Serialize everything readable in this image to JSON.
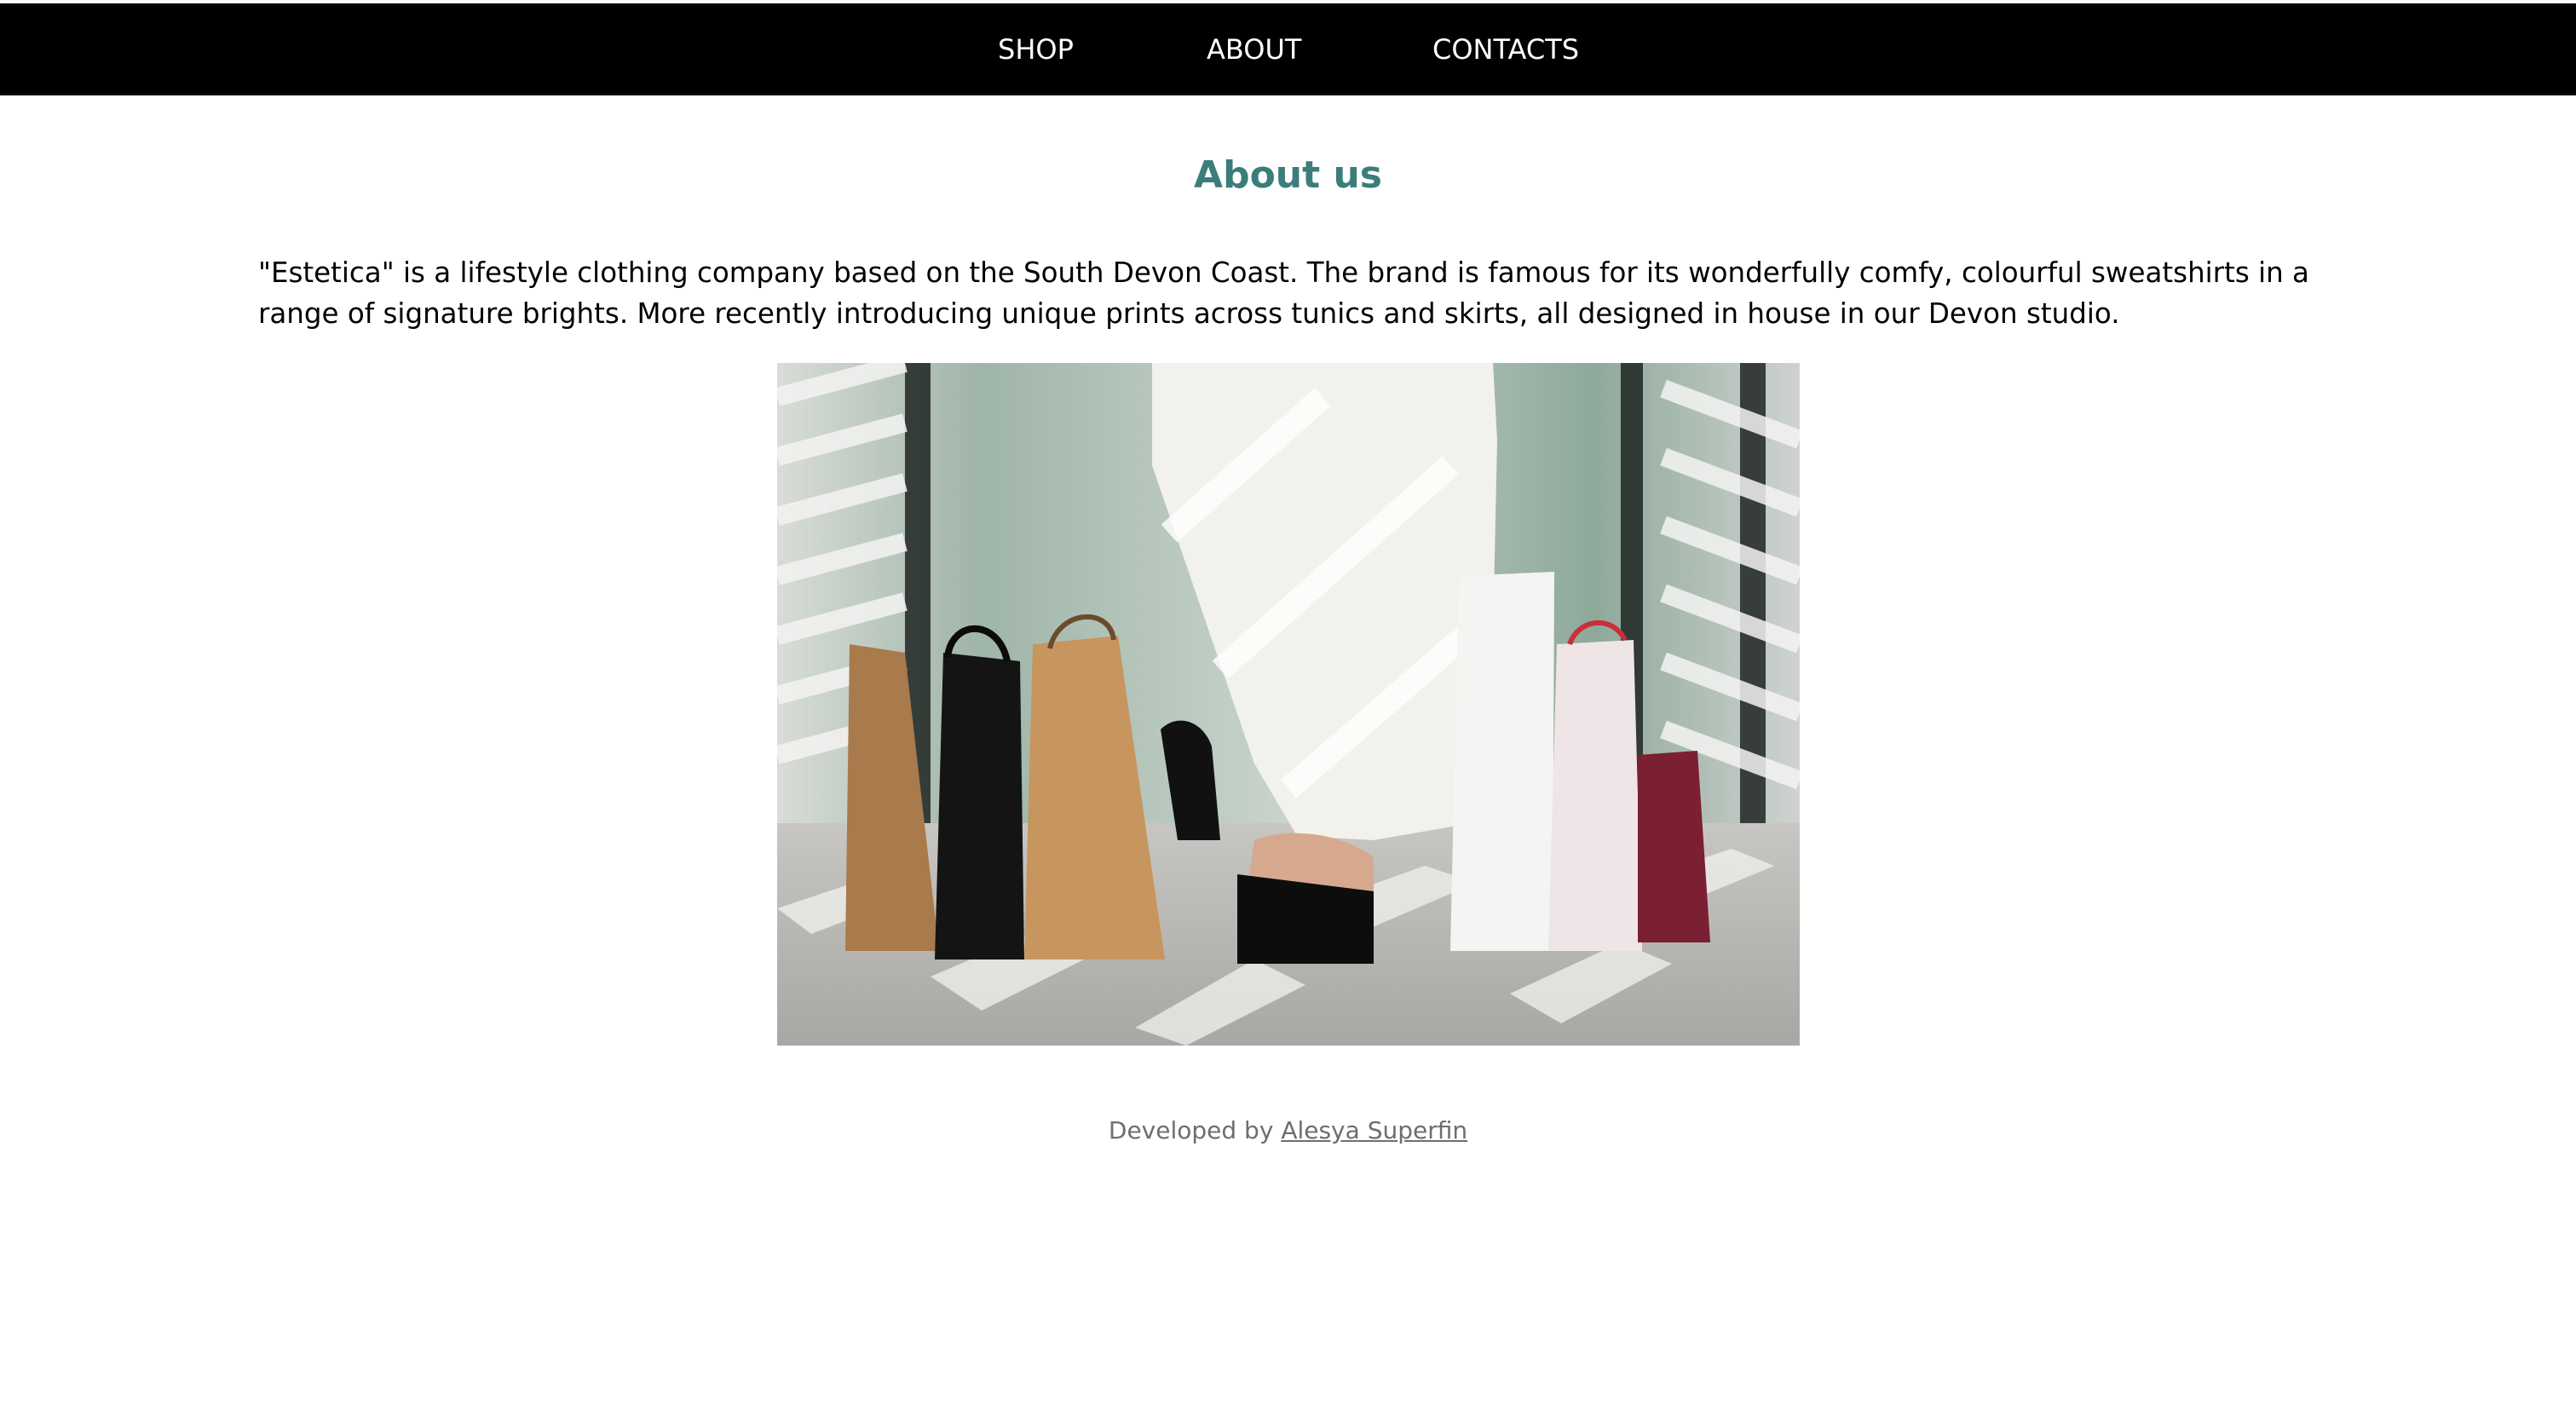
{
  "nav": {
    "items": [
      {
        "label": "SHOP"
      },
      {
        "label": "ABOUT"
      },
      {
        "label": "CONTACTS"
      }
    ]
  },
  "main": {
    "title": "About us",
    "description": "\"Estetica\" is a lifestyle clothing company based on the South Devon Coast. The brand is famous for its wonderfully comfy, colourful sweatshirts in a range of signature brights. More recently introducing unique prints across tunics and skirts, all designed in house in our Devon studio."
  },
  "footer": {
    "prefix": "Developed by",
    "author": "Alesya Superfin"
  },
  "colors": {
    "nav_background": "#000000",
    "nav_text": "#ffffff",
    "title": "#3a7d7a",
    "body_text": "#000000",
    "footer_text": "#6e6e6e"
  }
}
